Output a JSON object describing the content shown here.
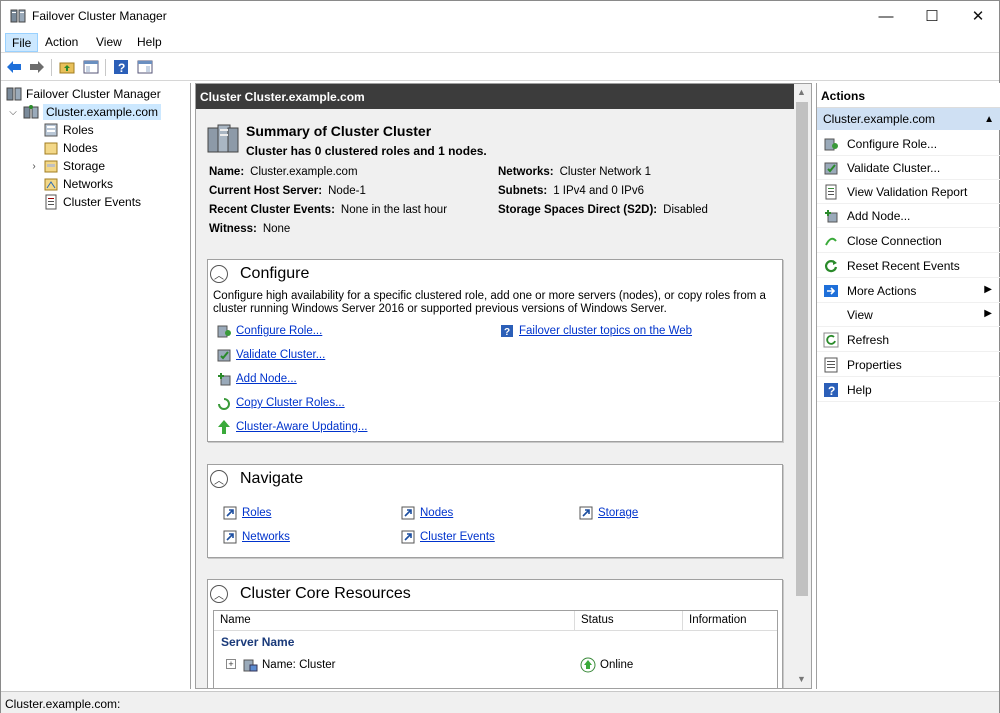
{
  "window": {
    "title": "Failover Cluster Manager"
  },
  "menu": [
    "File",
    "Action",
    "View",
    "Help"
  ],
  "tree": {
    "root": "Failover Cluster Manager",
    "cluster": "Cluster.example.com",
    "items": [
      "Roles",
      "Nodes",
      "Storage",
      "Networks",
      "Cluster Events"
    ]
  },
  "center": {
    "header": "Cluster Cluster.example.com",
    "summary_title": "Summary of Cluster Cluster",
    "summary_sub": "Cluster has 0 clustered roles and 1 nodes.",
    "left_kv": [
      {
        "k": "Name:",
        "v": "Cluster.example.com"
      },
      {
        "k": "Current Host Server:",
        "v": "Node-1"
      },
      {
        "k": "Recent Cluster Events:",
        "v": "None in the last hour"
      },
      {
        "k": "Witness:",
        "v": "None"
      }
    ],
    "right_kv": [
      {
        "k": "Networks:",
        "v": "Cluster Network 1"
      },
      {
        "k": "Subnets:",
        "v": "1 IPv4 and 0 IPv6"
      },
      {
        "k": "Storage Spaces Direct (S2D):",
        "v": "Disabled"
      }
    ],
    "configure": {
      "title": "Configure",
      "desc": "Configure high availability for a specific clustered role, add one or more servers (nodes), or copy roles from a cluster running Windows Server 2016 or supported previous versions of Windows Server.",
      "links": [
        "Configure Role...",
        "Validate Cluster...",
        "Add Node...",
        "Copy Cluster Roles...",
        "Cluster-Aware Updating..."
      ],
      "help_link": "Failover cluster topics on the Web"
    },
    "navigate": {
      "title": "Navigate",
      "links": [
        "Roles",
        "Nodes",
        "Storage",
        "Networks",
        "Cluster Events"
      ]
    },
    "core": {
      "title": "Cluster Core Resources",
      "columns": [
        "Name",
        "Status",
        "Information"
      ],
      "group": "Server Name",
      "row": {
        "name": "Name: Cluster",
        "status": "Online",
        "info": ""
      }
    }
  },
  "actions": {
    "header": "Actions",
    "sub": "Cluster.example.com",
    "items": [
      "Configure Role...",
      "Validate Cluster...",
      "View Validation Report",
      "Add Node...",
      "Close Connection",
      "Reset Recent Events",
      "More Actions",
      "View",
      "Refresh",
      "Properties",
      "Help"
    ]
  },
  "status": "Cluster.example.com:"
}
